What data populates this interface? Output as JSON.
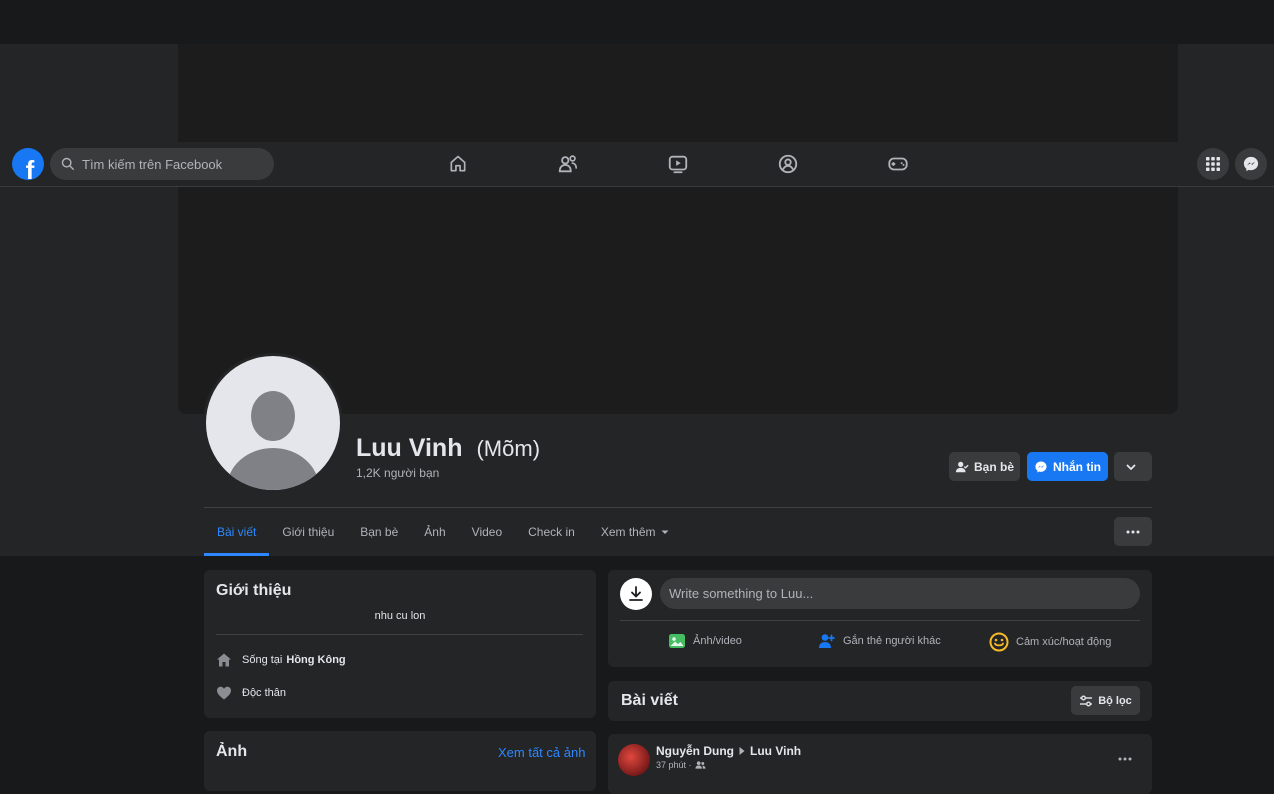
{
  "nav": {
    "search_placeholder": "Tìm kiếm trên Facebook",
    "logo_letter": "f",
    "icons": [
      "home-icon",
      "friends-icon",
      "watch-icon",
      "groups-icon",
      "gaming-icon"
    ],
    "right_icons": [
      "menu-grid-icon",
      "messenger-icon"
    ]
  },
  "profile": {
    "name": "Luu Vinh",
    "nickname": "(Mõm)",
    "friends_count": "1,2K người bạn",
    "buttons": {
      "friends": "Bạn bè",
      "message": "Nhắn tin"
    }
  },
  "tabs": [
    {
      "label": "Bài viết",
      "active": true
    },
    {
      "label": "Giới thiệu"
    },
    {
      "label": "Bạn bè"
    },
    {
      "label": "Ảnh"
    },
    {
      "label": "Video"
    },
    {
      "label": "Check in"
    },
    {
      "label": "Xem thêm"
    }
  ],
  "intro": {
    "title": "Giới thiệu",
    "bio": "nhu cu lon",
    "lives_prefix": "Sống tại",
    "lives_place": "Hồng Kông",
    "relationship": "Độc thân"
  },
  "photos": {
    "title": "Ảnh",
    "see_all": "Xem tất cả ảnh"
  },
  "composer": {
    "placeholder": "Write something to Luu...",
    "actions": [
      "Ảnh/video",
      "Gắn thẻ người khác",
      "Cảm xúc/hoạt động"
    ]
  },
  "posts_header": {
    "title": "Bài viết",
    "filter": "Bộ lọc"
  },
  "post": {
    "author": "Nguyễn Dung",
    "target": "Luu Vinh",
    "time": "37 phút ·"
  },
  "colors": {
    "accent": "#2d88ff",
    "brand": "#1877f2",
    "surface": "#242526",
    "background": "#18191a"
  }
}
